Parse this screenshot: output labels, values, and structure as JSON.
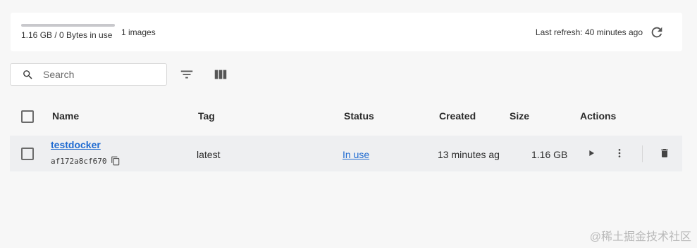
{
  "summary": {
    "usage_text": "1.16 GB / 0 Bytes in use",
    "usage_fraction": 0,
    "images_count": "1 images",
    "last_refresh": "Last refresh: 40 minutes ago"
  },
  "toolbar": {
    "search_placeholder": "Search"
  },
  "table": {
    "columns": [
      "Name",
      "Tag",
      "Status",
      "Created",
      "Size",
      "Actions"
    ],
    "rows": [
      {
        "name": "testdocker",
        "id": "af172a8cf670",
        "tag": "latest",
        "status": "In use",
        "created": "13 minutes ag",
        "size": "1.16 GB"
      }
    ]
  },
  "watermark": "@稀土掘金技术社区",
  "icons": {
    "refresh": "refresh-icon",
    "search": "search-icon",
    "filter": "filter-icon",
    "columns": "columns-icon",
    "copy": "copy-icon",
    "run": "play-icon",
    "more": "more-vertical-icon",
    "delete": "trash-icon"
  },
  "colors": {
    "accent": "#1f6bd1",
    "background": "#f7f7f7",
    "row": "#eeeff1"
  }
}
